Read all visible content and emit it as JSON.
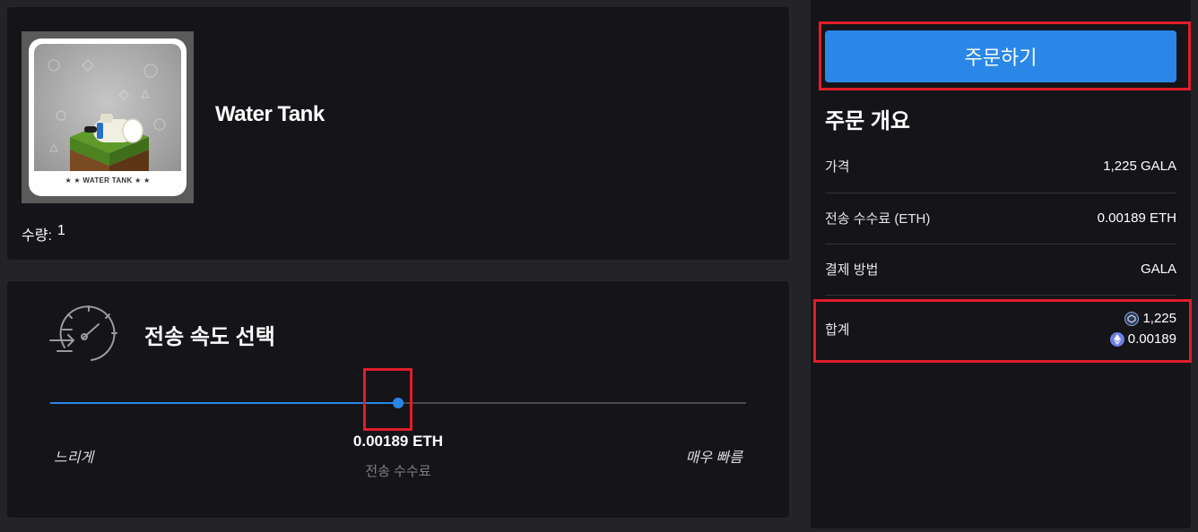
{
  "item": {
    "title": "Water Tank",
    "thumbnail_label": "★ ★  WATER TANK  ★ ★",
    "quantity_label": "수량:",
    "quantity_value": "1"
  },
  "speed": {
    "title": "전송 속도 선택",
    "slow_label": "느리게",
    "fast_label": "매우 빠름",
    "fee_value": "0.00189 ETH",
    "fee_caption": "전송 수수료",
    "slider_level": 0.5
  },
  "summary": {
    "order_button": "주문하기",
    "title": "주문 개요",
    "rows": [
      {
        "label": "가격",
        "value": "1,225 GALA"
      },
      {
        "label": "전송 수수료 (ETH)",
        "value": "0.00189 ETH"
      },
      {
        "label": "결제 방법",
        "value": "GALA"
      }
    ],
    "total_label": "합계",
    "total_gala": "1,225",
    "total_eth": "0.00189"
  },
  "colors": {
    "accent": "#2a87e8",
    "highlight": "#e01e2a",
    "card_bg": "#151418",
    "page_bg": "#242328"
  },
  "icons": [
    "speedometer-icon",
    "gala-coin-icon",
    "eth-coin-icon"
  ]
}
